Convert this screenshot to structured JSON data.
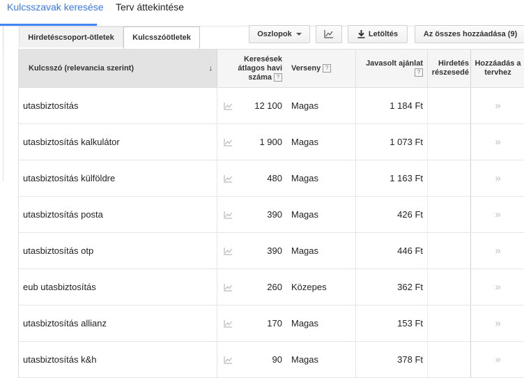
{
  "top_tabs": [
    {
      "label": "Kulcsszavak keresése",
      "active": true
    },
    {
      "label": "Terv áttekintése",
      "active": false
    }
  ],
  "sub_tabs": [
    {
      "label": "Hirdetéscsoport-ötletek",
      "active": false
    },
    {
      "label": "Kulcsszóötletek",
      "active": true
    }
  ],
  "toolbar": {
    "columns_label": "Oszlopok",
    "download_label": "Letöltés",
    "add_all_label": "Az összes hozzáadása (9)"
  },
  "table": {
    "headers": {
      "keyword": "Kulcsszó (relevancia szerint)",
      "volume_line1": "Keresések",
      "volume_line2": "átlagos havi",
      "volume_line3": "száma",
      "competition": "Verseny",
      "bid": "Javasolt ajánlat",
      "share_line1": "Hirdetés",
      "share_line2": "részesedé",
      "add_line1": "Hozzáadás a",
      "add_line2": "tervhez"
    },
    "rows": [
      {
        "keyword": "utasbiztosítás",
        "volume": "12 100",
        "competition": "Magas",
        "bid": "1 184 Ft"
      },
      {
        "keyword": "utasbiztosítás kalkulátor",
        "volume": "1 900",
        "competition": "Magas",
        "bid": "1 073 Ft"
      },
      {
        "keyword": "utasbiztosítás külföldre",
        "volume": "480",
        "competition": "Magas",
        "bid": "1 163 Ft"
      },
      {
        "keyword": "utasbiztosítás posta",
        "volume": "390",
        "competition": "Magas",
        "bid": "426 Ft"
      },
      {
        "keyword": "utasbiztosítás otp",
        "volume": "390",
        "competition": "Magas",
        "bid": "446 Ft"
      },
      {
        "keyword": "eub utasbiztosítás",
        "volume": "260",
        "competition": "Közepes",
        "bid": "362 Ft"
      },
      {
        "keyword": "utasbiztosítás allianz",
        "volume": "170",
        "competition": "Magas",
        "bid": "153 Ft"
      },
      {
        "keyword": "utasbiztosítás k&h",
        "volume": "90",
        "competition": "Magas",
        "bid": "378 Ft"
      }
    ]
  },
  "icons": {
    "trend": "line-chart-icon",
    "download": "download-icon",
    "add": "double-chevron-right-icon",
    "sort": "sort-down-arrow-icon"
  },
  "colors": {
    "accent": "#4285f4"
  }
}
